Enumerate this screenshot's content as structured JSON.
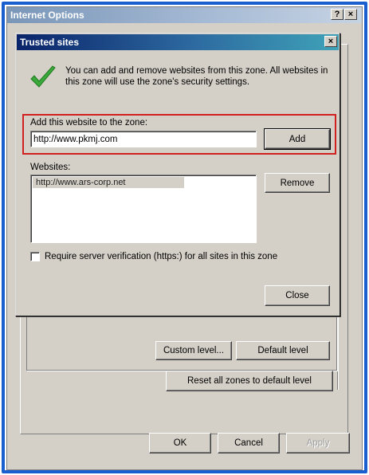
{
  "internet_options": {
    "title": "Internet Options",
    "help_glyph": "?",
    "close_glyph": "×",
    "buttons": {
      "custom_level": "Custom level...",
      "default_level": "Default level",
      "reset_all": "Reset all zones to default level",
      "ok": "OK",
      "cancel": "Cancel",
      "apply": "Apply"
    }
  },
  "trusted_sites": {
    "title": "Trusted sites",
    "close_glyph": "×",
    "description": "You can add and remove websites from this zone. All websites in this zone will use the zone's security settings.",
    "add_label": "Add this website to the zone:",
    "add_value": "http://www.pkmj.com",
    "add_button": "Add",
    "websites_label": "Websites:",
    "websites": [
      "http://www.ars-corp.net"
    ],
    "remove_button": "Remove",
    "https_label": "Require server verification (https:) for all sites in this zone",
    "https_checked": false,
    "close_button": "Close"
  },
  "colors": {
    "frame_blue": "#1a5fd0",
    "highlight_red": "#d02020",
    "check_green": "#3aa83a"
  },
  "icons": {
    "check": "checkmark-icon"
  }
}
